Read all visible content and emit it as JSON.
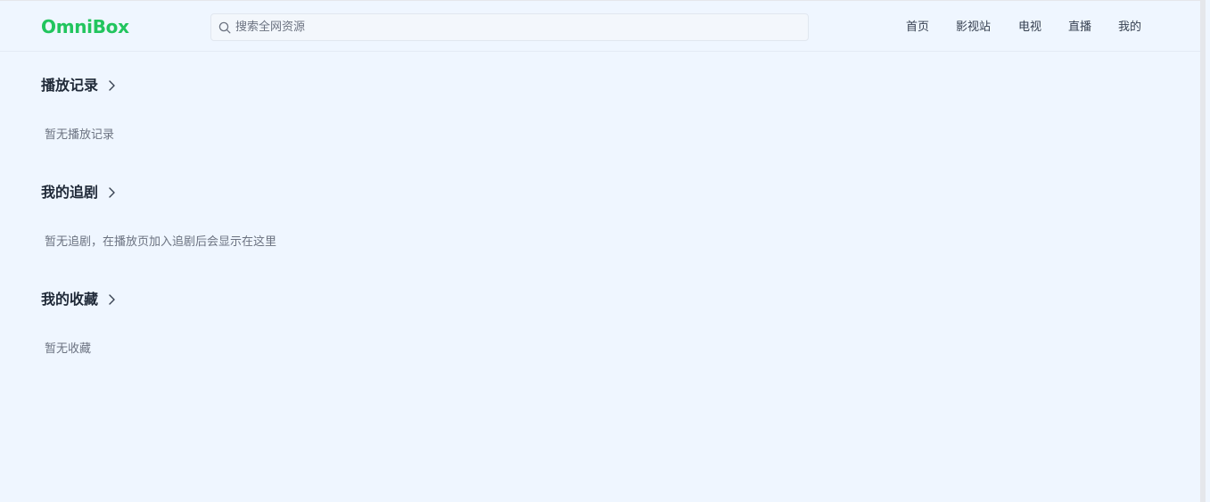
{
  "header": {
    "logo": "OmniBox",
    "search_placeholder": "搜索全网资源",
    "nav": [
      "首页",
      "影视站",
      "电视",
      "直播",
      "我的"
    ]
  },
  "sections": [
    {
      "title": "播放记录",
      "empty_text": "暂无播放记录"
    },
    {
      "title": "我的追剧",
      "empty_text": "暂无追剧，在播放页加入追剧后会显示在这里"
    },
    {
      "title": "我的收藏",
      "empty_text": "暂无收藏"
    }
  ],
  "colors": {
    "brand": "#22c55e",
    "background": "#eff6ff"
  },
  "icons": {
    "search": "search-icon",
    "chevron": "chevron-right-icon"
  }
}
